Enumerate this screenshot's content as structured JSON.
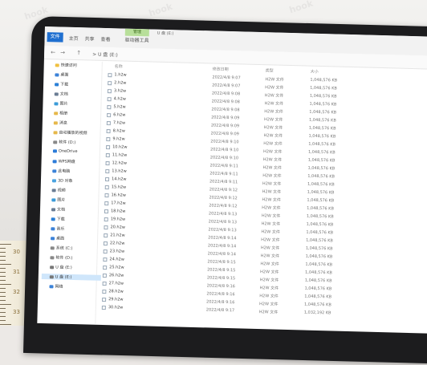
{
  "ribbon": {
    "file_tab": "文件",
    "tabs": [
      "主页",
      "共享",
      "查看",
      "驱动器工具"
    ],
    "manage_tab": "管理",
    "title": "U 盘 (E:)"
  },
  "address_bar": {
    "back": "←",
    "forward": "→",
    "up": "↑",
    "path": "> U 盘 (E:)"
  },
  "sidebar": {
    "quick_access": "快速访问",
    "items": [
      {
        "label": "桌面",
        "icon": "desktop-icon",
        "color": "#3b82d8"
      },
      {
        "label": "下载",
        "icon": "download-icon",
        "color": "#2a7fd6"
      },
      {
        "label": "文档",
        "icon": "document-icon",
        "color": "#6b7d94"
      },
      {
        "label": "图片",
        "icon": "picture-icon",
        "color": "#3b9bd8"
      },
      {
        "label": "相册",
        "icon": "folder-icon",
        "color": "#e6b84a"
      },
      {
        "label": "消息",
        "icon": "folder-icon",
        "color": "#e6b84a"
      },
      {
        "label": "自动播放的视频",
        "icon": "folder-icon",
        "color": "#e6b84a"
      },
      {
        "label": "软件 (D:)",
        "icon": "drive-icon",
        "color": "#888888"
      },
      {
        "label": "OneDrive",
        "icon": "cloud-icon",
        "color": "#2b7bd8"
      },
      {
        "label": "WPS网盘",
        "icon": "cloud-icon",
        "color": "#2b7bd8"
      },
      {
        "label": "此电脑",
        "icon": "computer-icon",
        "color": "#3b82d8"
      },
      {
        "label": "3D 对象",
        "icon": "cube-icon",
        "color": "#4aa3e0"
      },
      {
        "label": "视频",
        "icon": "video-icon",
        "color": "#6b7d94"
      },
      {
        "label": "图片",
        "icon": "picture-icon",
        "color": "#3b9bd8"
      },
      {
        "label": "文档",
        "icon": "document-icon",
        "color": "#6b7d94"
      },
      {
        "label": "下载",
        "icon": "download-icon",
        "color": "#2a7fd6"
      },
      {
        "label": "音乐",
        "icon": "music-icon",
        "color": "#3b82d8"
      },
      {
        "label": "桌面",
        "icon": "desktop-icon",
        "color": "#3b82d8"
      },
      {
        "label": "系统 (C:)",
        "icon": "drive-icon",
        "color": "#888888"
      },
      {
        "label": "软件 (D:)",
        "icon": "drive-icon",
        "color": "#888888"
      },
      {
        "label": "U 盘 (E:)",
        "icon": "usb-drive-icon",
        "color": "#777777"
      },
      {
        "label": "U 盘 (E:)",
        "icon": "usb-drive-icon",
        "color": "#777777",
        "selected": true
      },
      {
        "label": "网络",
        "icon": "network-icon",
        "color": "#3b82d8"
      }
    ]
  },
  "columns": {
    "name": "名称",
    "date": "修改日期",
    "type": "类型",
    "size": "大小"
  },
  "files": [
    {
      "name": "1.h2w",
      "date": "2022/4/8 9:07",
      "type": "H2W 文件",
      "size": "1,048,576 KB"
    },
    {
      "name": "2.h2w",
      "date": "2022/4/8 9:07",
      "type": "H2W 文件",
      "size": "1,048,576 KB"
    },
    {
      "name": "3.h2w",
      "date": "2022/4/8 9:08",
      "type": "H2W 文件",
      "size": "1,048,576 KB"
    },
    {
      "name": "4.h2w",
      "date": "2022/4/8 9:08",
      "type": "H2W 文件",
      "size": "1,048,576 KB"
    },
    {
      "name": "5.h2w",
      "date": "2022/4/8 9:08",
      "type": "H2W 文件",
      "size": "1,048,576 KB"
    },
    {
      "name": "6.h2w",
      "date": "2022/4/8 9:09",
      "type": "H2W 文件",
      "size": "1,048,576 KB"
    },
    {
      "name": "7.h2w",
      "date": "2022/4/8 9:09",
      "type": "H2W 文件",
      "size": "1,048,576 KB"
    },
    {
      "name": "8.h2w",
      "date": "2022/4/8 9:09",
      "type": "H2W 文件",
      "size": "1,048,576 KB"
    },
    {
      "name": "9.h2w",
      "date": "2022/4/8 9:10",
      "type": "H2W 文件",
      "size": "1,048,576 KB"
    },
    {
      "name": "10.h2w",
      "date": "2022/4/8 9:10",
      "type": "H2W 文件",
      "size": "1,048,576 KB"
    },
    {
      "name": "11.h2w",
      "date": "2022/4/8 9:10",
      "type": "H2W 文件",
      "size": "1,048,576 KB"
    },
    {
      "name": "12.h2w",
      "date": "2022/4/8 9:11",
      "type": "H2W 文件",
      "size": "1,048,576 KB"
    },
    {
      "name": "13.h2w",
      "date": "2022/4/8 9:11",
      "type": "H2W 文件",
      "size": "1,048,576 KB"
    },
    {
      "name": "14.h2w",
      "date": "2022/4/8 9:11",
      "type": "H2W 文件",
      "size": "1,048,576 KB"
    },
    {
      "name": "15.h2w",
      "date": "2022/4/8 9:12",
      "type": "H2W 文件",
      "size": "1,048,576 KB"
    },
    {
      "name": "16.h2w",
      "date": "2022/4/8 9:12",
      "type": "H2W 文件",
      "size": "1,048,576 KB"
    },
    {
      "name": "17.h2w",
      "date": "2022/4/8 9:12",
      "type": "H2W 文件",
      "size": "1,048,576 KB"
    },
    {
      "name": "18.h2w",
      "date": "2022/4/8 9:13",
      "type": "H2W 文件",
      "size": "1,048,576 KB"
    },
    {
      "name": "19.h2w",
      "date": "2022/4/8 9:13",
      "type": "H2W 文件",
      "size": "1,048,576 KB"
    },
    {
      "name": "20.h2w",
      "date": "2022/4/8 9:13",
      "type": "H2W 文件",
      "size": "1,048,576 KB"
    },
    {
      "name": "21.h2w",
      "date": "2022/4/8 9:14",
      "type": "H2W 文件",
      "size": "1,048,576 KB"
    },
    {
      "name": "22.h2w",
      "date": "2022/4/8 9:14",
      "type": "H2W 文件",
      "size": "1,048,576 KB"
    },
    {
      "name": "23.h2w",
      "date": "2022/4/8 9:14",
      "type": "H2W 文件",
      "size": "1,048,576 KB"
    },
    {
      "name": "24.h2w",
      "date": "2022/4/8 9:15",
      "type": "H2W 文件",
      "size": "1,048,576 KB"
    },
    {
      "name": "25.h2w",
      "date": "2022/4/8 9:15",
      "type": "H2W 文件",
      "size": "1,048,576 KB"
    },
    {
      "name": "26.h2w",
      "date": "2022/4/8 9:15",
      "type": "H2W 文件",
      "size": "1,048,576 KB"
    },
    {
      "name": "27.h2w",
      "date": "2022/4/8 9:16",
      "type": "H2W 文件",
      "size": "1,048,576 KB"
    },
    {
      "name": "28.h2w",
      "date": "2022/4/8 9:16",
      "type": "H2W 文件",
      "size": "1,048,576 KB"
    },
    {
      "name": "29.h2w",
      "date": "2022/4/8 9:16",
      "type": "H2W 文件",
      "size": "1,048,576 KB"
    },
    {
      "name": "30.h2w",
      "date": "2022/4/8 9:17",
      "type": "H2W 文件",
      "size": "1,032,192 KB"
    }
  ],
  "ruler_numbers": [
    "30",
    "31",
    "32",
    "33"
  ]
}
